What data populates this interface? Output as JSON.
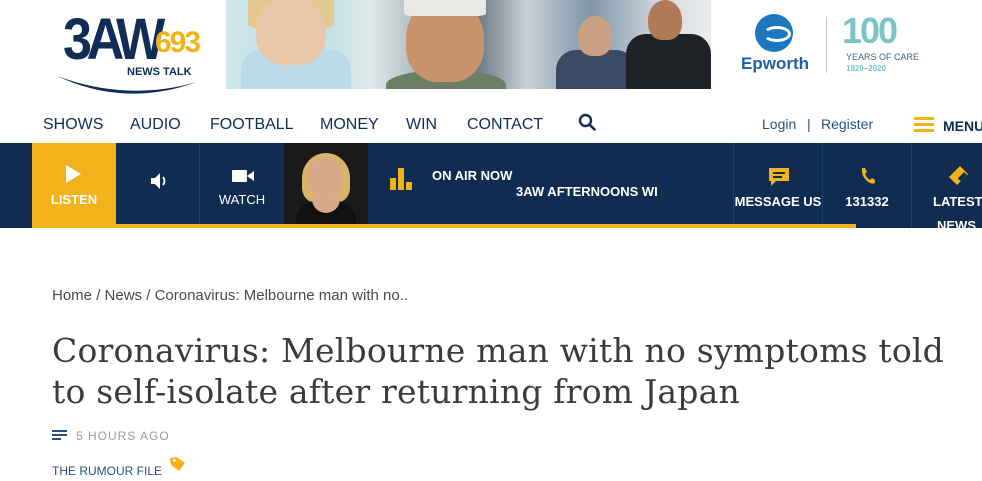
{
  "logo": {
    "big": "3AW",
    "freq": "693",
    "sub": "NEWS TALK"
  },
  "sponsor": {
    "name": "Epworth",
    "hundred": "100",
    "years": "YEARS OF CARE",
    "dates": "1920–2020"
  },
  "nav": {
    "items": [
      "SHOWS",
      "AUDIO",
      "FOOTBALL",
      "MONEY",
      "WIN",
      "CONTACT"
    ],
    "login": "Login",
    "sep": "|",
    "register": "Register",
    "menu": "MENU"
  },
  "player": {
    "listen": "LISTEN",
    "watch": "WATCH",
    "on_air": "ON AIR NOW",
    "show": "3AW AFTERNOONS WI",
    "message": "MESSAGE US",
    "phone": "131332",
    "latest": "LATEST",
    "latest2": "NEWS"
  },
  "article": {
    "breadcrumb": [
      "Home",
      "News",
      "Coronavirus: Melbourne man with no.."
    ],
    "crumb_sep": "/",
    "headline": "Coronavirus: Melbourne man with no symptoms told to self-isolate after returning from Japan",
    "time": "5 HOURS AGO",
    "tag": "THE RUMOUR FILE"
  },
  "colors": {
    "navy": "#112c51",
    "gold": "#f2b21b",
    "link": "#2a4f7e"
  }
}
